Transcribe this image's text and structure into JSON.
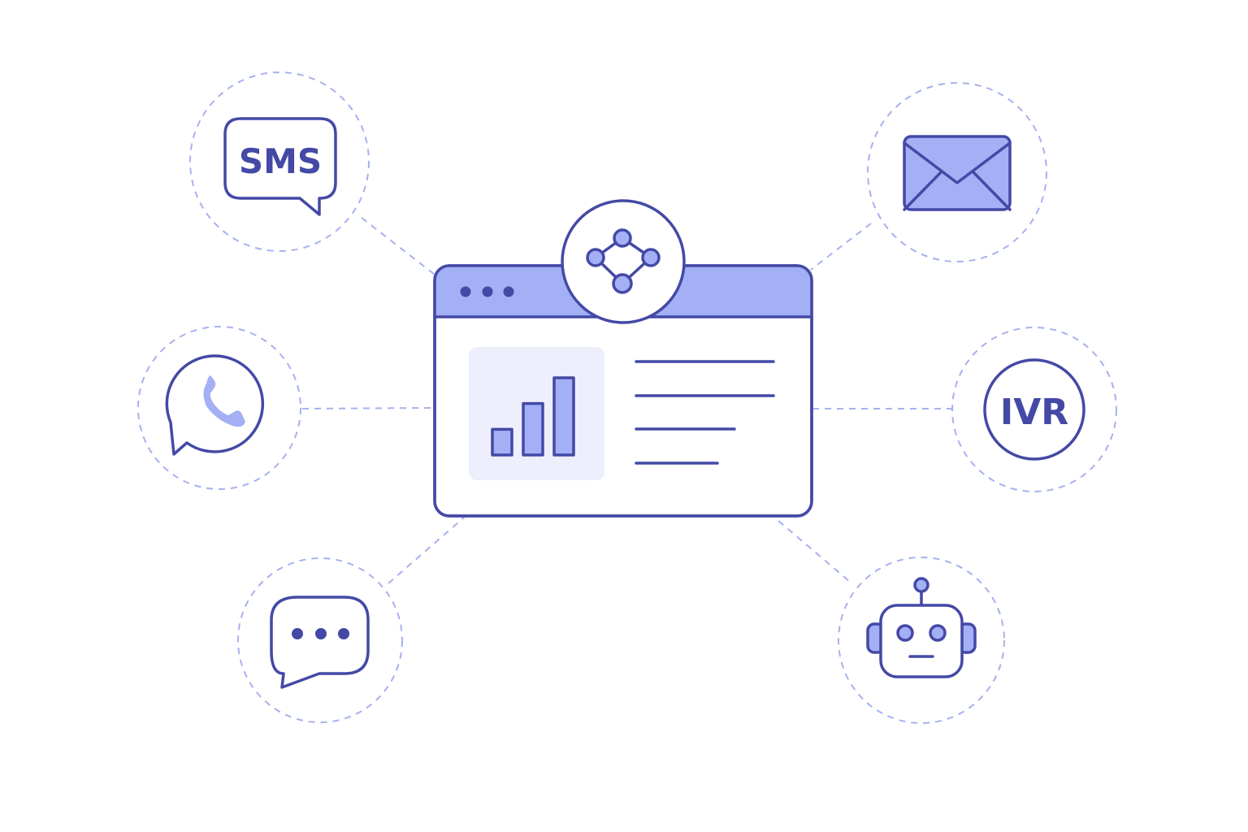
{
  "colors": {
    "ink": "#4449a6",
    "accent": "#a4b0f5",
    "panel": "#edf0fc",
    "dashed": "#a6b1ef",
    "background": "#ffffff"
  },
  "hub": {
    "header_icon": "network-nodes-icon",
    "window_controls": "three-dots",
    "panel_icon": "bar-chart-icon",
    "bar_chart_values": [
      1,
      2,
      3
    ],
    "text_lines": 4
  },
  "channels": [
    {
      "id": "sms",
      "icon": "sms-bubble-icon",
      "label": "SMS"
    },
    {
      "id": "whatsapp",
      "icon": "whatsapp-phone-icon"
    },
    {
      "id": "chat",
      "icon": "chat-bubble-dots-icon"
    },
    {
      "id": "email",
      "icon": "envelope-icon"
    },
    {
      "id": "ivr",
      "icon": "ivr-circle-icon",
      "label": "IVR"
    },
    {
      "id": "bot",
      "icon": "robot-icon"
    }
  ]
}
